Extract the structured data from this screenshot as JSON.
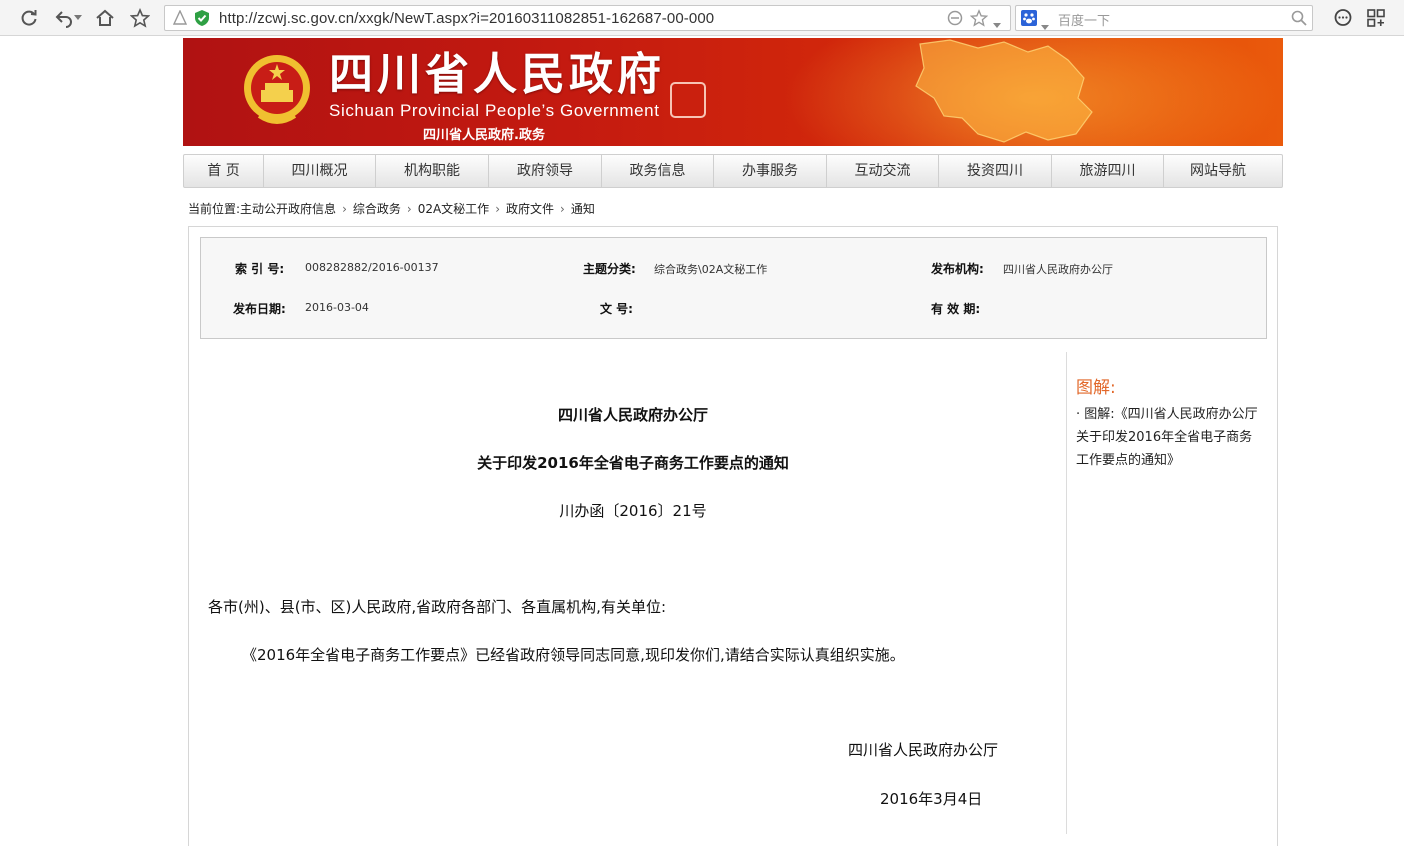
{
  "browser": {
    "url": "http://zcwj.sc.gov.cn/xxgk/NewT.aspx?i=20160311082851-162687-00-000",
    "search_placeholder": "百度一下"
  },
  "banner": {
    "title_cn": "四川省人民政府",
    "title_en": "Sichuan Provincial People’s Government",
    "subtitle": "四川省人民政府.政务"
  },
  "nav": {
    "items": [
      "首 页",
      "四川概况",
      "机构职能",
      "政府领导",
      "政务信息",
      "办事服务",
      "互动交流",
      "投资四川",
      "旅游四川",
      "网站导航"
    ]
  },
  "breadcrumb": {
    "prefix": "当前位置:",
    "items": [
      "主动公开政府信息",
      "综合政务",
      "02A文秘工作",
      "政府文件",
      "通知"
    ]
  },
  "meta": {
    "index_label": "索 引 号:",
    "index_value": "008282882/2016-00137",
    "category_label": "主题分类:",
    "category_value": "综合政务\\02A文秘工作",
    "agency_label": "发布机构:",
    "agency_value": "四川省人民政府办公厅",
    "date_label": "发布日期:",
    "date_value": "2016-03-04",
    "docno_label": "文 号:",
    "docno_value": "",
    "validity_label": "有 效 期:",
    "validity_value": ""
  },
  "article": {
    "issuer": "四川省人民政府办公厅",
    "title": "关于印发2016年全省电子商务工作要点的通知",
    "doc_number": "川办函〔2016〕21号",
    "salutation": "各市(州)、县(市、区)人民政府,省政府各部门、各直属机构,有关单位:",
    "body": "《2016年全省电子商务工作要点》已经省政府领导同志同意,现印发你们,请结合实际认真组织实施。",
    "signature": "四川省人民政府办公厅",
    "date": "2016年3月4日"
  },
  "sidebar": {
    "title": "图解:",
    "link": "· 图解:《四川省人民政府办公厅关于印发2016年全省电子商务工作要点的通知》"
  },
  "colors": {
    "banner_red": "#c41a10",
    "banner_orange": "#ea5a0c",
    "sidebar_title": "#e2682a"
  }
}
